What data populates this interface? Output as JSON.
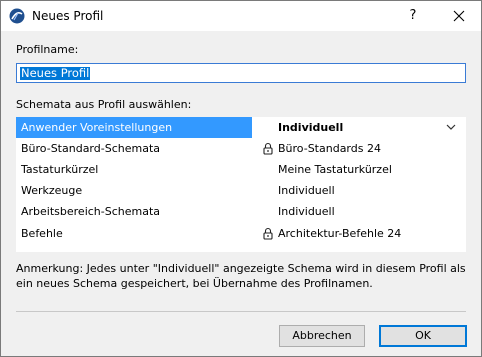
{
  "window": {
    "title": "Neues Profil",
    "help_label": "?",
    "app_icon": "archicad-logo-icon",
    "close_icon": "close-icon"
  },
  "profile_name": {
    "label": "Profilname:",
    "value": "Neues Profil"
  },
  "schemes": {
    "label": "Schemata aus Profil auswählen:",
    "rows": [
      {
        "name": "Anwender Voreinstellungen",
        "value": "Individuell",
        "selected": true,
        "locked": false,
        "dropdown": true
      },
      {
        "name": "Büro-Standard-Schemata",
        "value": "Büro-Standards 24",
        "selected": false,
        "locked": true
      },
      {
        "name": "Tastaturkürzel",
        "value": "Meine Tastaturkürzel",
        "selected": false,
        "locked": false
      },
      {
        "name": "Werkzeuge",
        "value": "Individuell",
        "selected": false,
        "locked": false
      },
      {
        "name": "Arbeitsbereich-Schemata",
        "value": "Individuell",
        "selected": false,
        "locked": false
      },
      {
        "name": "Befehle",
        "value": "Architektur-Befehle 24",
        "selected": false,
        "locked": true
      }
    ]
  },
  "note": "Anmerkung: Jedes unter \"Individuell\" angezeigte Schema wird in diesem Profil als ein neues Schema gespeichert, bei Übernahme des Profilnamen.",
  "buttons": {
    "cancel": "Abbrechen",
    "ok": "OK"
  },
  "colors": {
    "selection": "#3399ff",
    "accent": "#0078d7"
  }
}
